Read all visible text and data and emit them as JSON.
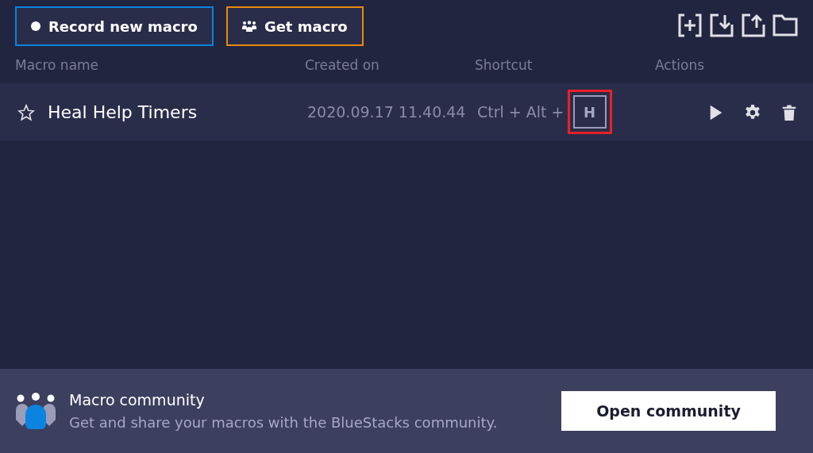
{
  "toolbar": {
    "buttons": [
      {
        "kind": "record",
        "label": "Record new macro"
      },
      {
        "kind": "get",
        "label": "Get macro"
      }
    ]
  },
  "table": {
    "columns": [
      "Macro name",
      "Created on",
      "Shortcut",
      "Actions"
    ],
    "rows": [
      {
        "favorite": false,
        "name": "Heal Help Timers",
        "created_on": "2020.09.17 11.40.44",
        "shortcut_prefix": "Ctrl + Alt +",
        "shortcut_key": "H",
        "highlighted": true
      }
    ]
  },
  "footer": {
    "title": "Macro community",
    "description": "Get and share your macros with the BlueStacks community.",
    "button": "Open community"
  }
}
